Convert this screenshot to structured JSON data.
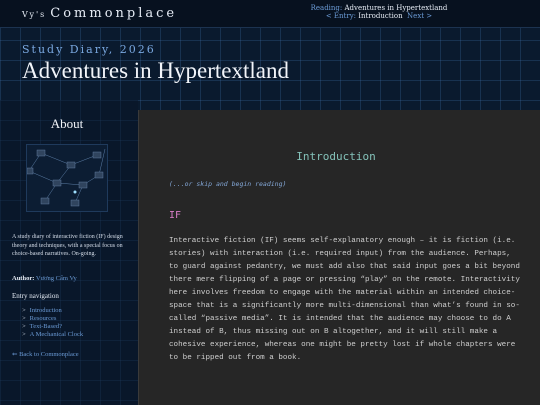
{
  "site": {
    "prefix": "Vy's",
    "name": "Commonplace"
  },
  "reading": {
    "label": "Reading:",
    "value": "Adventures in Hypertextland",
    "prev_arrow": "<",
    "entry_label": "Entry:",
    "entry_value": "Introduction",
    "next_label": "Next >"
  },
  "header": {
    "subtitle": "Study Diary, 2026",
    "title": "Adventures in Hypertextland"
  },
  "sidebar": {
    "about": "About",
    "description": "A study diary of interactive fiction (IF) design theory and techniques, with a special focus on choice-based narratives. On-going.",
    "author_label": "Author:",
    "author_name": "Vương Cẩm Vy",
    "nav_heading": "Entry navigation",
    "nav_items": [
      {
        "arrow": ">",
        "label": "Introduction"
      },
      {
        "arrow": ">",
        "label": "Resources"
      },
      {
        "arrow": ">",
        "label": "Text-Based?"
      },
      {
        "arrow": ">",
        "label": "A Mechanical Clock"
      }
    ],
    "back": "⇐ Back to Commonplace"
  },
  "content": {
    "title": "Introduction",
    "skip": "(...or skip and begin reading)",
    "section": "IF",
    "paragraph": "Interactive fiction (IF) seems self-explanatory enough – it is fiction (i.e. stories) with interaction (i.e. required input) from the audience. Perhaps, to guard against pedantry, we must add also that said input goes a bit beyond there mere flipping of a page or pressing “play” on the remote. Interactivity here involves freedom to engage with the material within an intended choice-space that is a significantly more multi-dimensional than what’s found in so-called “passive media”. It is intended that the audience may choose to do A instead of B, thus missing out on B altogether, and it will still make a cohesive experience, whereas one might be pretty lost if whole chapters were to be ripped out from a book."
  },
  "colors": {
    "background": "#0a1a2e",
    "accent": "#6b9bd6",
    "content_bg": "#262626",
    "title_teal": "#84c2b9",
    "section_pink": "#d97fc8"
  }
}
